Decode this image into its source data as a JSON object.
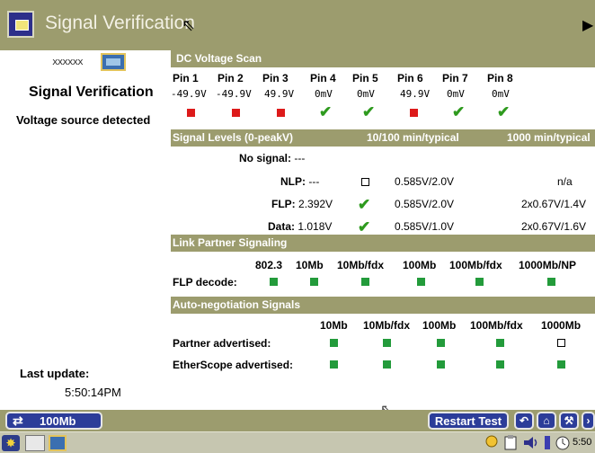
{
  "window": {
    "title": "Signal Verification"
  },
  "sidebar": {
    "cable_glyph": "xxxxxx",
    "title": "Signal Verification",
    "status": "Voltage source detected",
    "last_update_label": "Last update:",
    "last_update_time": "5:50:14PM"
  },
  "dc_voltage": {
    "header": "DC Voltage Scan",
    "pins": [
      {
        "label": "Pin 1",
        "voltage": "-49.9V",
        "status": "fail"
      },
      {
        "label": "Pin 2",
        "voltage": "-49.9V",
        "status": "fail"
      },
      {
        "label": "Pin 3",
        "voltage": "49.9V",
        "status": "fail"
      },
      {
        "label": "Pin 4",
        "voltage": "0mV",
        "status": "pass"
      },
      {
        "label": "Pin 5",
        "voltage": "0mV",
        "status": "pass"
      },
      {
        "label": "Pin 6",
        "voltage": "49.9V",
        "status": "fail"
      },
      {
        "label": "Pin 7",
        "voltage": "0mV",
        "status": "pass"
      },
      {
        "label": "Pin 8",
        "voltage": "0mV",
        "status": "pass"
      }
    ]
  },
  "signal_levels": {
    "header": "Signal Levels (0-peakV)",
    "col_10_100": "10/100 min/typical",
    "col_1000": "1000 min/typical",
    "rows": {
      "no_signal": {
        "label": "No signal:",
        "value": "---"
      },
      "nlp": {
        "label": "NLP:",
        "value": "---",
        "mark": "empty",
        "range_10_100": "0.585V/2.0V",
        "range_1000": "n/a"
      },
      "flp": {
        "label": "FLP:",
        "value": "2.392V",
        "mark": "pass",
        "range_10_100": "0.585V/2.0V",
        "range_1000": "2x0.67V/1.4V"
      },
      "data": {
        "label": "Data:",
        "value": "1.018V",
        "mark": "pass",
        "range_10_100": "0.585V/1.0V",
        "range_1000": "2x0.67V/1.6V"
      }
    }
  },
  "link_partner": {
    "header": "Link Partner Signaling",
    "columns": [
      "802.3",
      "10Mb",
      "10Mb/fdx",
      "100Mb",
      "100Mb/fdx",
      "1000Mb/NP"
    ],
    "row_label": "FLP decode:",
    "values": [
      true,
      true,
      true,
      true,
      true,
      true
    ]
  },
  "autoneg": {
    "header": "Auto-negotiation Signals",
    "columns": [
      "10Mb",
      "10Mb/fdx",
      "100Mb",
      "100Mb/fdx",
      "1000Mb"
    ],
    "rows": [
      {
        "label": "Partner advertised:",
        "values": [
          true,
          true,
          true,
          true,
          false
        ]
      },
      {
        "label": "EtherScope advertised:",
        "values": [
          true,
          true,
          true,
          true,
          true
        ]
      }
    ]
  },
  "bottom": {
    "speed": "100Mb",
    "restart": "Restart Test"
  },
  "taskbar": {
    "clock": "5:50"
  },
  "colors": {
    "header_bar": "#9c9c6e",
    "fail": "#dd1a1a",
    "pass_check": "#2e9a1e",
    "pass_square": "#239b3b",
    "button": "#2c3d99"
  },
  "icons": {
    "app": "signal-verification-app-icon",
    "pointer": "mouse-pointer-icon",
    "pass": "checkmark-icon",
    "fail": "red-square-icon"
  }
}
